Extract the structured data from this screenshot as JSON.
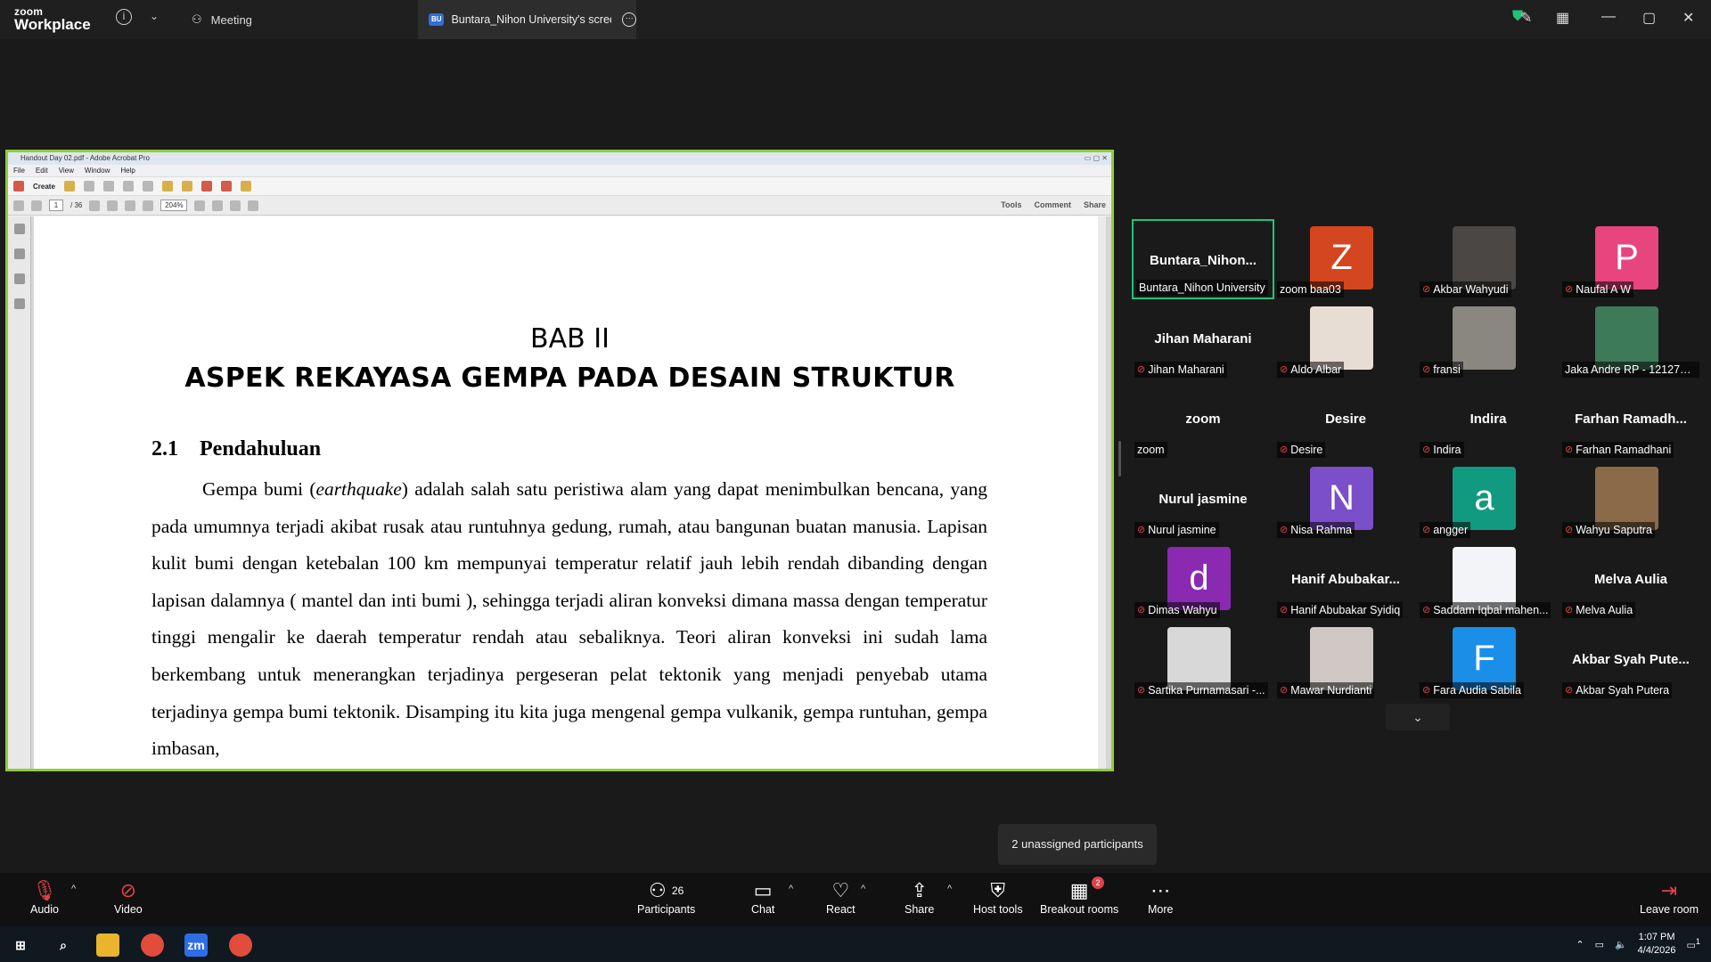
{
  "app": {
    "brand_top": "zoom",
    "brand_bottom": "Workplace"
  },
  "tabs": {
    "meeting_label": "Meeting",
    "screen_label": "Buntara_Nihon University's screen",
    "screen_badge": "BU"
  },
  "acrobat": {
    "window_title": "Handout Day 02.pdf - Adobe Acrobat Pro",
    "menu": [
      "File",
      "Edit",
      "View",
      "Window",
      "Help"
    ],
    "create_label": "Create",
    "page_current": "1",
    "page_total": "/ 36",
    "zoom": "204%",
    "tool_links": [
      "Tools",
      "Comment",
      "Share"
    ]
  },
  "document": {
    "chapter": "BAB II",
    "chapter_title": "ASPEK REKAYASA GEMPA PADA DESAIN STRUKTUR",
    "section_number": "2.1",
    "section_title": "Pendahuluan",
    "para_start": "Gempa bumi (",
    "para_italic": "earthquake",
    "para_rest": ") adalah salah satu peristiwa alam yang dapat menimbulkan bencana, yang pada umumnya terjadi akibat rusak atau runtuhnya gedung, rumah, atau bangunan buatan manusia.  Lapisan kulit bumi dengan ketebalan 100 km mempunyai temperatur relatif jauh lebih rendah dibanding dengan lapisan dalamnya ( mantel dan inti bumi ), sehingga terjadi aliran konveksi dimana massa dengan temperatur tinggi mengalir ke daerah temperatur rendah atau sebaliknya. Teori aliran konveksi ini sudah lama berkembang untuk menerangkan terjadinya pergeseran pelat tektonik yang menjadi penyebab utama terjadinya gempa bumi tektonik. Disamping itu kita juga mengenal gempa vulkanik, gempa runtuhan, gempa imbasan,"
  },
  "participants": [
    {
      "display": "Buntara_Nihon...",
      "label": "Buntara_Nihon University",
      "muted": false,
      "active": true
    },
    {
      "avatar": "Z",
      "color": "#d4461f",
      "label": "zoom baa03",
      "muted": false
    },
    {
      "photo": "#4a4744",
      "label": "Akbar Wahyudi",
      "muted": true
    },
    {
      "avatar": "P",
      "color": "#e8457e",
      "label": "Naufal A W",
      "muted": true
    },
    {
      "display": "Jihan Maharani",
      "label": "Jihan Maharani",
      "muted": true
    },
    {
      "photo": "#e8ddd5",
      "label": "Aldo Albar",
      "muted": true
    },
    {
      "photo": "#8a8680",
      "label": "fransi",
      "muted": true
    },
    {
      "photo": "#3d7a5a",
      "label": "Jaka Andre RP - 1212721...",
      "muted": false
    },
    {
      "display": "zoom",
      "label": "zoom",
      "muted": false
    },
    {
      "display": "Desire",
      "label": "Desire",
      "muted": true
    },
    {
      "display": "Indira",
      "label": "Indira",
      "muted": true
    },
    {
      "display": "Farhan Ramadh...",
      "label": "Farhan Ramadhani",
      "muted": true
    },
    {
      "display": "Nurul jasmine",
      "label": "Nurul jasmine",
      "muted": true
    },
    {
      "avatar": "N",
      "color": "#7a4fc9",
      "label": "Nisa Rahma",
      "muted": true
    },
    {
      "avatar": "a",
      "color": "#129a80",
      "label": "angger",
      "muted": true
    },
    {
      "photo": "#8b6a4a",
      "label": "Wahyu Saputra",
      "muted": true
    },
    {
      "avatar": "d",
      "color": "#8a2ab0",
      "label": "Dimas Wahyu",
      "muted": true
    },
    {
      "display": "Hanif  Abubakar...",
      "label": "Hanif Abubakar Syidiq",
      "muted": true
    },
    {
      "photo": "#f2f4f7",
      "label": "Saddam Iqbal mahen...",
      "muted": true
    },
    {
      "display": "Melva Aulia",
      "label": "Melva Aulia",
      "muted": true
    },
    {
      "photo": "#d8d8d8",
      "label": "Sartika Purnamasari -...",
      "muted": true
    },
    {
      "photo": "#cfc8c4",
      "label": "Mawar Nurdianti",
      "muted": true
    },
    {
      "avatar": "F",
      "color": "#1b8ee8",
      "label": "Fara Audia Sabila",
      "muted": true
    },
    {
      "display": "Akbar Syah Pute...",
      "label": "Akbar Syah Putera",
      "muted": true
    }
  ],
  "tooltip": "2 unassigned participants",
  "controls": {
    "audio": "Audio",
    "video": "Video",
    "participants": "Participants",
    "participants_count": "26",
    "chat": "Chat",
    "react": "React",
    "share": "Share",
    "host_tools": "Host tools",
    "breakout": "Breakout rooms",
    "breakout_badge": "2",
    "more": "More",
    "leave": "Leave room"
  },
  "taskbar": {
    "time": "1:07 PM",
    "date": "4/4/2026",
    "notif_count": "1",
    "zoom_label": "zm"
  },
  "colors": {
    "active_border": "#1fc47a",
    "share_border": "#8fce3a",
    "muted_mic": "#e0424a"
  }
}
